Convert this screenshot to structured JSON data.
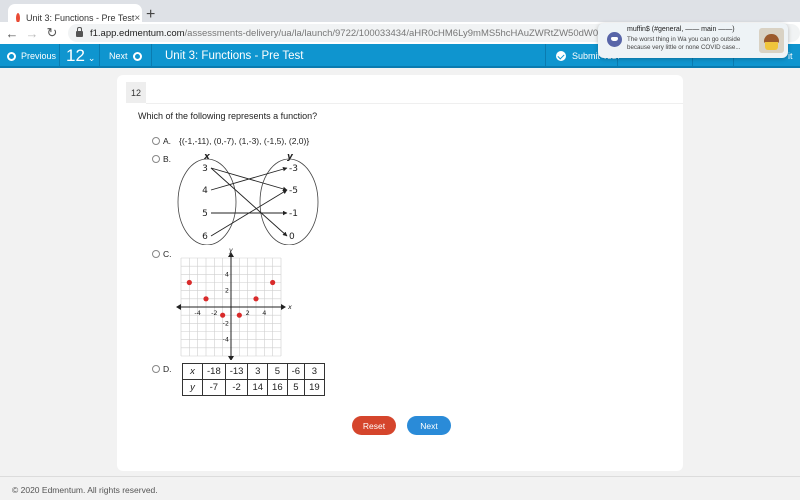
{
  "browser": {
    "tab_title": "Unit 3: Functions - Pre Test",
    "tab_close": "×",
    "new_tab": "+",
    "url_host": "f1.app.edmentum.com",
    "url_path": "/assessments-delivery/ua/la/launch/9722/100033434/aHR0cHM6Ly9mMS5hcHAuZWRtZW50dW0uY29tL2xlYXJuZXIvc2V0dXAvd2Vi"
  },
  "toolbar": {
    "previous_label": "Previous",
    "question_number": "12",
    "next_label": "Next",
    "title": "Unit 3: Functions - Pre Test",
    "submit_label": "Submit Test",
    "trailing_label": "it"
  },
  "notification": {
    "app_icon": "discord-icon",
    "title": "muffin$ (#general, —— main ——)",
    "body": "The worst thing in Wa you can go outside because very little or none COVID  case..."
  },
  "question": {
    "number": "12",
    "prompt": "Which of the following represents a function?",
    "options": [
      {
        "letter": "A.",
        "text": "{(-1,-11), (0,-7), (1,-3), (-1,5), (2,0)}"
      },
      {
        "letter": "B."
      },
      {
        "letter": "C."
      },
      {
        "letter": "D."
      }
    ],
    "mapping": {
      "domain_label": "x",
      "range_label": "y",
      "domain": [
        "3",
        "4",
        "5",
        "6"
      ],
      "range": [
        "-3",
        "-5",
        "-1",
        "0"
      ],
      "arrows": [
        {
          "from": "3",
          "to": "-5"
        },
        {
          "from": "3",
          "to": "0"
        },
        {
          "from": "4",
          "to": "-3"
        },
        {
          "from": "5",
          "to": "-1"
        },
        {
          "from": "6",
          "to": "-5"
        }
      ]
    },
    "graph": {
      "x_label": "x",
      "y_label": "y",
      "x_ticks": [
        "-4",
        "-2",
        "2",
        "4"
      ],
      "y_ticks": [
        "4",
        "2",
        "-2",
        "-4"
      ],
      "range": [
        -6,
        6
      ],
      "point_color": "#d92b2b",
      "points": [
        [
          -5,
          3
        ],
        [
          -3,
          1
        ],
        [
          -1,
          -1
        ],
        [
          1,
          -1
        ],
        [
          3,
          1
        ],
        [
          5,
          3
        ]
      ]
    },
    "table": {
      "x_header": "x",
      "y_header": "y",
      "x": [
        "-18",
        "-13",
        "3",
        "5",
        "-6",
        "3"
      ],
      "y": [
        "-7",
        "-2",
        "14",
        "16",
        "5",
        "19"
      ]
    }
  },
  "buttons": {
    "reset": "Reset",
    "next": "Next"
  },
  "footer": {
    "copyright": "© 2020 Edmentum. All rights reserved."
  },
  "colors": {
    "toolbar": "#0f95cf",
    "reset": "#d5452c",
    "next": "#2a8bd8"
  }
}
